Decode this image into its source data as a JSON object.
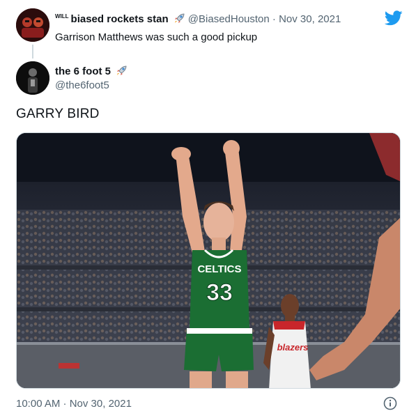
{
  "parent_tweet": {
    "prefix": "WILL",
    "name": "biased rockets stan",
    "handle": "@BiasedHouston",
    "date": "· Nov 30, 2021",
    "text": "Garrison Matthews was such a good pickup"
  },
  "main_tweet": {
    "name": "the 6 foot 5",
    "handle": "@the6foot5",
    "text": "GARRY BIRD",
    "photo": {
      "jersey_team": "CELTICS",
      "jersey_number": "33",
      "opponent_jersey": "blazers"
    },
    "timestamp": "10:00 AM · Nov 30, 2021"
  },
  "icons": {
    "brand": "twitter-bird-icon",
    "emoji": "rocket-icon",
    "info": "info-icon"
  },
  "colors": {
    "twitter_blue": "#1d9bf0",
    "secondary_text": "#536471",
    "celtics_green": "#1b6e33"
  }
}
